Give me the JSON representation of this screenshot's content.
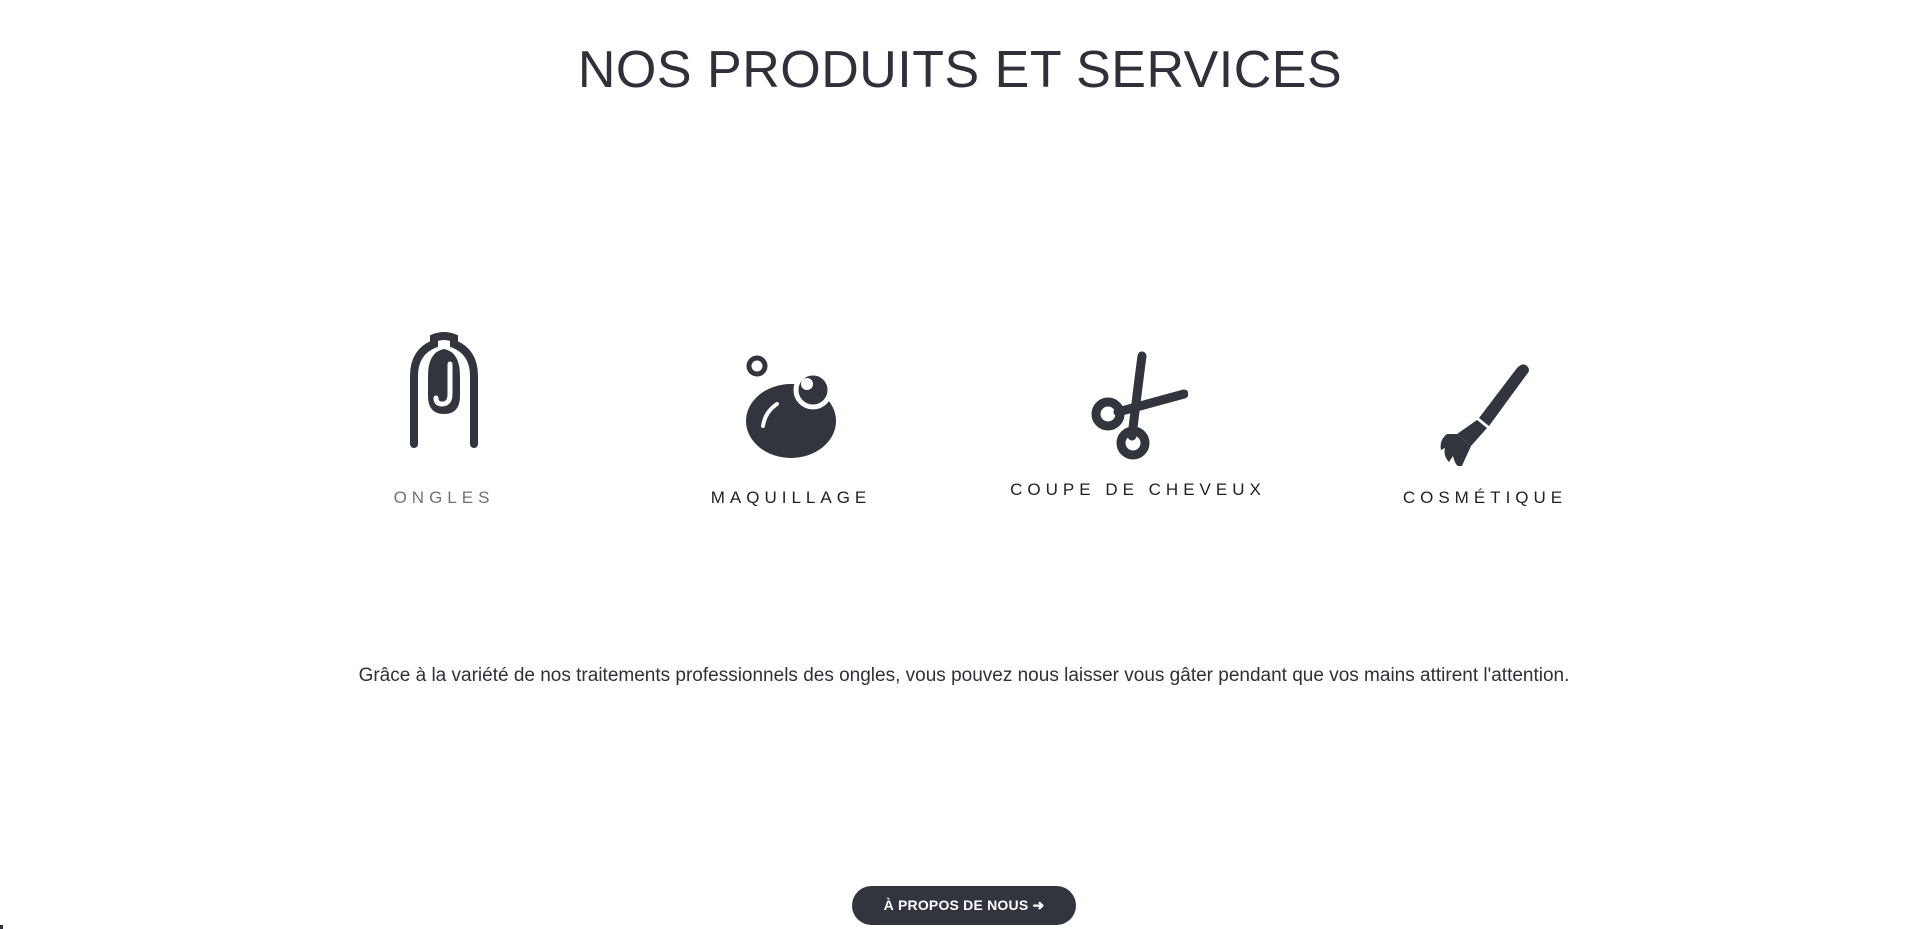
{
  "section": {
    "title": "NOS PRODUITS ET SERVICES"
  },
  "services": [
    {
      "label": "ONGLES",
      "icon": "nail-icon",
      "active": true
    },
    {
      "label": "MAQUILLAGE",
      "icon": "makeup-sponge-icon",
      "active": false
    },
    {
      "label": "COUPE DE CHEVEUX",
      "icon": "scissors-icon",
      "active": false
    },
    {
      "label": "COSMÉTIQUE",
      "icon": "brush-icon",
      "active": false
    }
  ],
  "description": "Grâce à la variété de nos traitements professionnels des ongles, vous pouvez nous laisser vous gâter pendant que vos mains attirent l'attention.",
  "about_button": {
    "label": "À PROPOS DE NOUS ➜"
  },
  "colors": {
    "text": "#2f3039",
    "active_label": "#6f7380",
    "button_bg": "#32343e",
    "button_text": "#ffffff",
    "background": "#ffffff"
  }
}
